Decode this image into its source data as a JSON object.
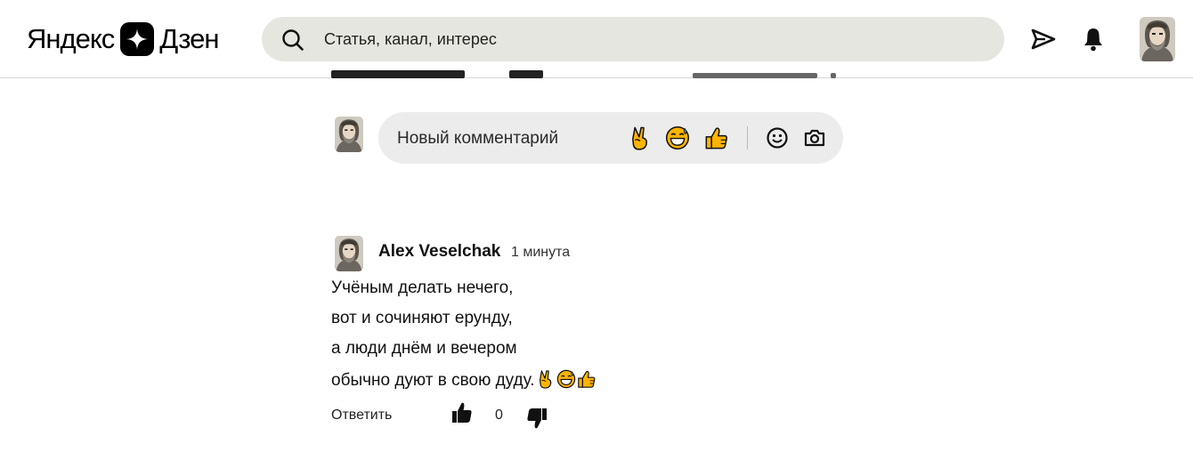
{
  "header": {
    "logo_text_left": "Яндекс",
    "logo_text_right": "Дзен",
    "search_placeholder": "Статья, канал, интерес",
    "icons": [
      "search-icon",
      "send-icon",
      "bell-icon",
      "user-avatar"
    ]
  },
  "comment_form": {
    "placeholder": "Новый комментарий",
    "quick_emojis": [
      "victory-hand-emoji",
      "grinning-sweat-emoji",
      "thumbs-up-emoji"
    ],
    "tools": [
      "smiley-icon",
      "camera-icon"
    ]
  },
  "comment": {
    "author": "Alex Veselchak",
    "time": "1 минута",
    "lines": [
      "Учёным делать нечего,",
      "вот и сочиняют ерунду,",
      "а люди днём и вечером",
      "обычно дуют в свою дуду."
    ],
    "trailing_emojis": [
      "victory-hand-emoji",
      "grinning-sweat-emoji",
      "thumbs-up-emoji"
    ],
    "reply_label": "Ответить",
    "likes": "0"
  },
  "colors": {
    "search_bg": "#e6e6e0",
    "comment_box_bg": "#ececec",
    "emoji_yellow": "#ffb400",
    "icon_dark": "#111111"
  }
}
